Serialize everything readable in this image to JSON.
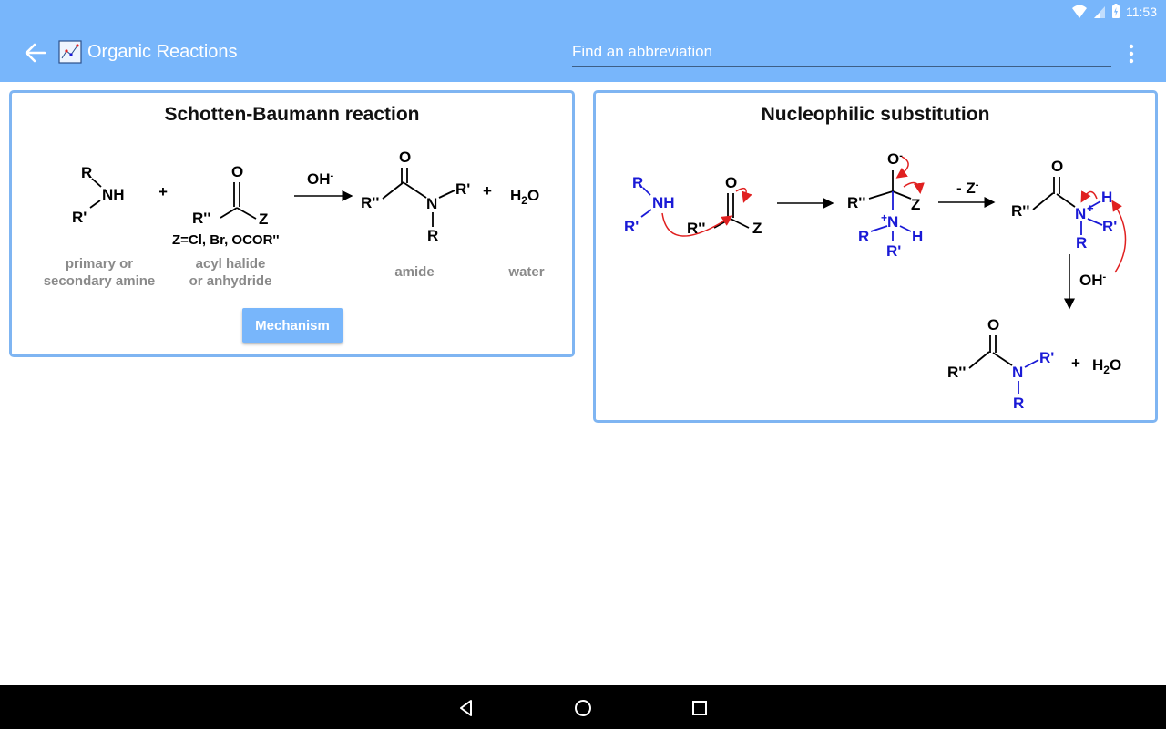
{
  "status_bar": {
    "time": "11:53"
  },
  "app_bar": {
    "title": "Organic Reactions",
    "search_placeholder": "Find an abbreviation",
    "search_value": ""
  },
  "colors": {
    "accent": "#78b6fb",
    "card_border": "#7fb5f2",
    "blue_chem": "#1a1ad6",
    "red_arrow": "#e02020"
  },
  "card_schotten": {
    "title": "Schotten-Baumann reaction",
    "reagent_condition": "OH-",
    "acyl_substituents": "Z=Cl, Br, OCOR''",
    "captions": {
      "amine": [
        "primary or",
        "secondary amine"
      ],
      "acyl": [
        "acyl halide",
        "or anhydride"
      ],
      "amide": "amide",
      "water": "water"
    },
    "button_label": "Mechanism"
  },
  "card_nucleo": {
    "title": "Nucleophilic substitution",
    "step_label_leaving": "- Z-",
    "step_label_base": "OH-"
  }
}
